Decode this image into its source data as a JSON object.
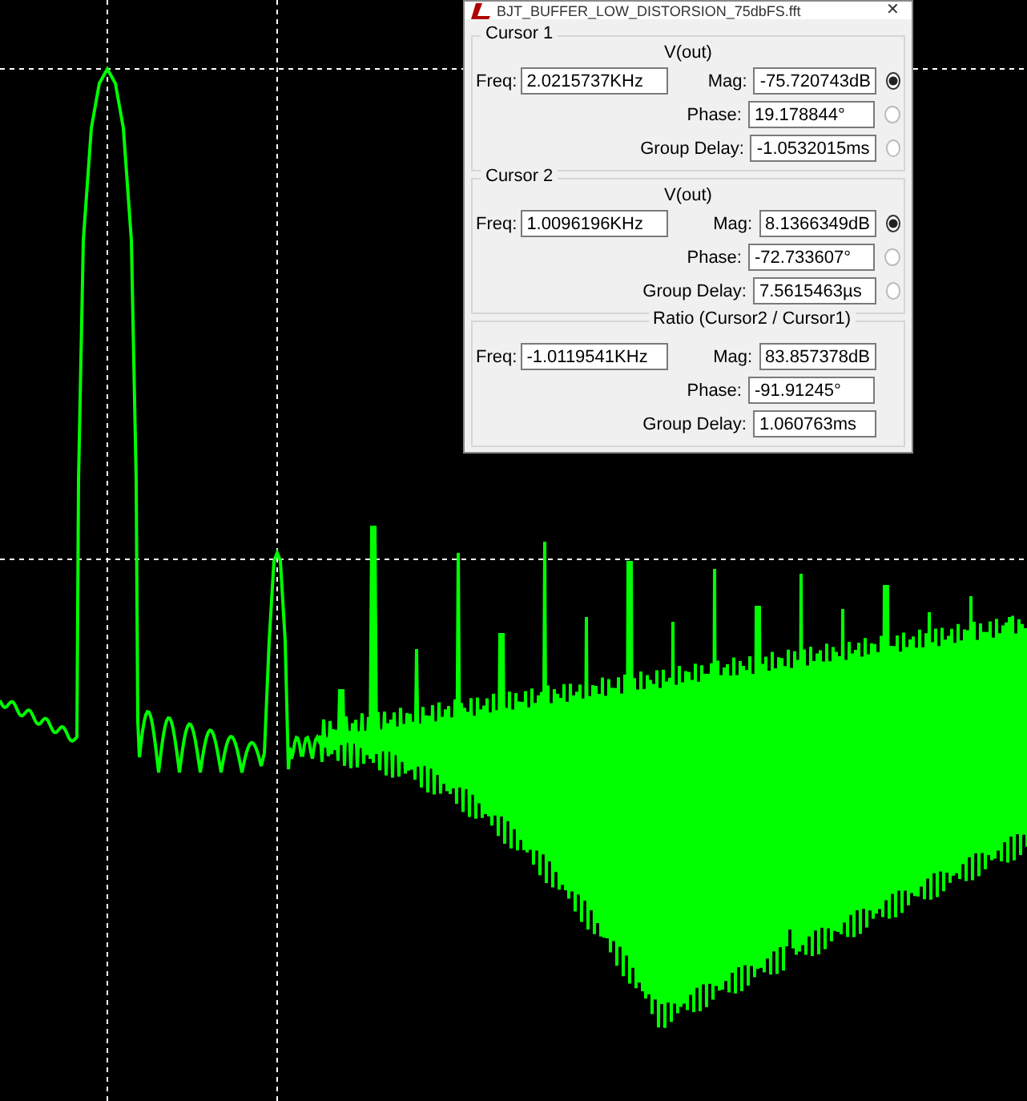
{
  "window": {
    "title": "BJT_BUFFER_LOW_DISTORSION_75dbFS.fft",
    "close": "✕"
  },
  "cursors": [
    {
      "legend": "Cursor 1",
      "trace": "V(out)",
      "freq_label": "Freq:",
      "freq": "2.0215737KHz",
      "rows": [
        {
          "label": "Mag:",
          "value": "-75.720743dB",
          "selected": true
        },
        {
          "label": "Phase:",
          "value": "19.178844°",
          "selected": false
        },
        {
          "label": "Group Delay:",
          "value": "-1.0532015ms",
          "selected": false
        }
      ]
    },
    {
      "legend": "Cursor 2",
      "trace": "V(out)",
      "freq_label": "Freq:",
      "freq": "1.0096196KHz",
      "rows": [
        {
          "label": "Mag:",
          "value": "8.1366349dB",
          "selected": true
        },
        {
          "label": "Phase:",
          "value": "-72.733607°",
          "selected": false
        },
        {
          "label": "Group Delay:",
          "value": "7.5615463µs",
          "selected": false
        }
      ]
    }
  ],
  "ratio": {
    "legend": "Ratio (Cursor2 / Cursor1)",
    "freq_label": "Freq:",
    "freq": "-1.0119541KHz",
    "rows": [
      {
        "label": "Mag:",
        "value": "83.857378dB"
      },
      {
        "label": "Phase:",
        "value": "-91.91245°"
      },
      {
        "label": "Group Delay:",
        "value": "1.060763ms"
      }
    ]
  }
}
